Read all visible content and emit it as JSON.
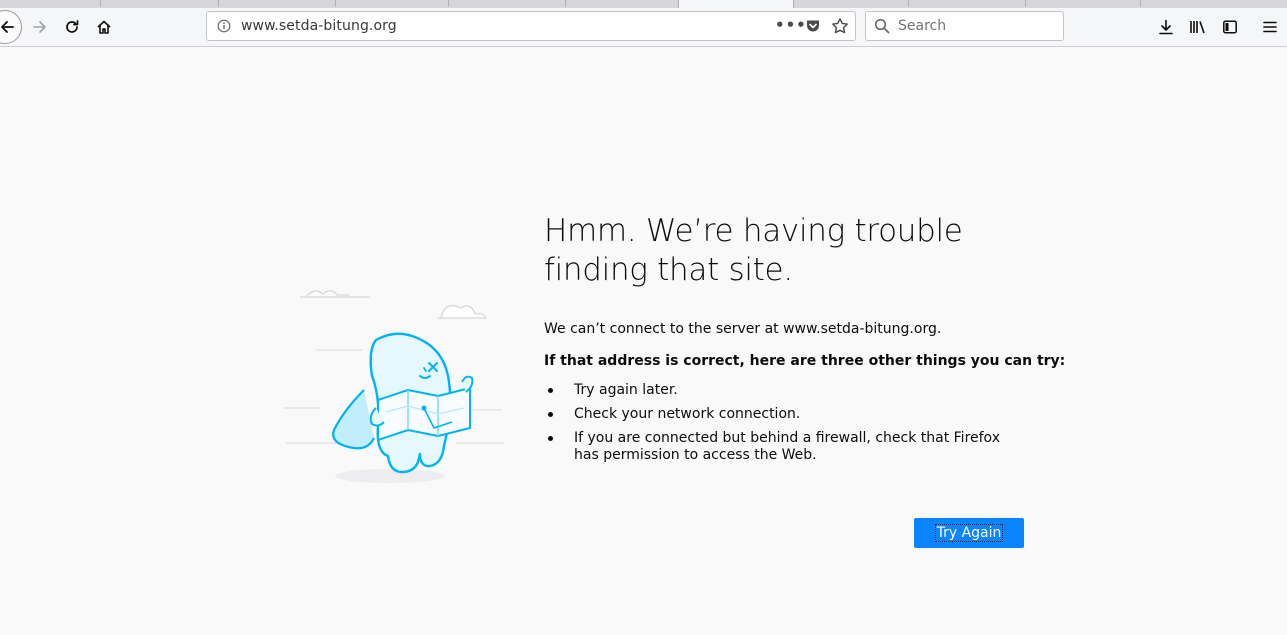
{
  "browser": {
    "url": "www.setda-bitung.org",
    "search_placeholder": "Search",
    "page_actions_label": "•••",
    "icons": {
      "back": "back-arrow-icon",
      "forward": "forward-arrow-icon",
      "reload": "reload-icon",
      "home": "home-icon",
      "site_info": "info-icon",
      "pocket": "pocket-icon",
      "bookmark": "star-icon",
      "search": "search-icon",
      "downloads": "download-icon",
      "library": "library-icon",
      "sidebar": "sidebar-icon",
      "menu": "hamburger-menu-icon"
    }
  },
  "error_page": {
    "title": "Hmm. We’re having trouble finding that site.",
    "description": "We can’t connect to the server at www.setda-bitung.org.",
    "subtitle": "If that address is correct, here are three other things you can try:",
    "suggestions": [
      "Try again later.",
      "Check your network connection.",
      "If you are connected but behind a firewall, check that Firefox has permission to access the Web."
    ],
    "try_again_label": "Try Again",
    "accent_color": "#0a84ff"
  }
}
